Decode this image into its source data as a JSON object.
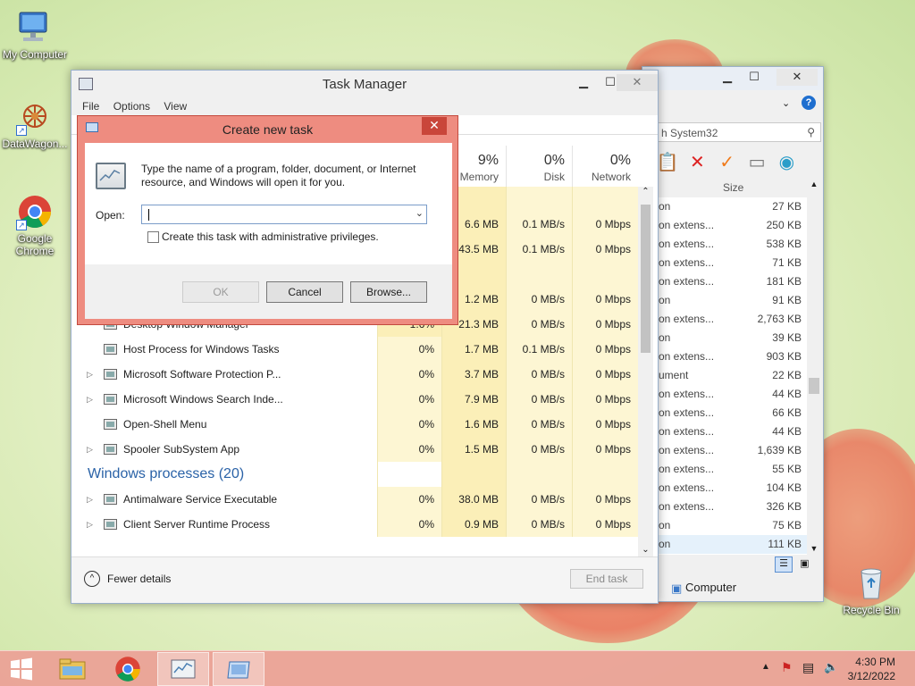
{
  "desktop": {
    "icons": [
      {
        "label": "My Computer",
        "icon": "computer-icon"
      },
      {
        "label": "DataWagon...",
        "icon": "datawagon-icon"
      },
      {
        "label": "Google Chrome",
        "icon": "chrome-icon"
      },
      {
        "label": "Recycle Bin",
        "icon": "recycle-bin-icon"
      }
    ]
  },
  "explorer": {
    "address": "h System32",
    "size_header": "Size",
    "status": "Computer",
    "rows": [
      {
        "name": "on",
        "size": "27 KB"
      },
      {
        "name": "on extens...",
        "size": "250 KB"
      },
      {
        "name": "on extens...",
        "size": "538 KB"
      },
      {
        "name": "on extens...",
        "size": "71 KB"
      },
      {
        "name": "on extens...",
        "size": "181 KB"
      },
      {
        "name": "on",
        "size": "91 KB"
      },
      {
        "name": "on extens...",
        "size": "2,763 KB"
      },
      {
        "name": "on",
        "size": "39 KB"
      },
      {
        "name": "on extens...",
        "size": "903 KB"
      },
      {
        "name": "ument",
        "size": "22 KB"
      },
      {
        "name": "on extens...",
        "size": "44 KB"
      },
      {
        "name": "on extens...",
        "size": "66 KB"
      },
      {
        "name": "on extens...",
        "size": "44 KB"
      },
      {
        "name": "on extens...",
        "size": "1,639 KB"
      },
      {
        "name": "on extens...",
        "size": "55 KB"
      },
      {
        "name": "on extens...",
        "size": "104 KB"
      },
      {
        "name": "on extens...",
        "size": "326 KB"
      },
      {
        "name": "on",
        "size": "75 KB"
      },
      {
        "name": "on",
        "size": "111 KB"
      }
    ]
  },
  "task_manager": {
    "title": "Task Manager",
    "menu": [
      "File",
      "Options",
      "View"
    ],
    "columns": [
      {
        "pct": "9%",
        "label": "Memory"
      },
      {
        "pct": "0%",
        "label": "Disk"
      },
      {
        "pct": "0%",
        "label": "Network"
      }
    ],
    "rows": [
      {
        "kind": "blank"
      },
      {
        "kind": "partial",
        "memory": "6.6 MB",
        "disk": "0.1 MB/s",
        "network": "0 Mbps"
      },
      {
        "kind": "partial",
        "memory": "43.5 MB",
        "disk": "0.1 MB/s",
        "network": "0 Mbps"
      },
      {
        "kind": "blank"
      },
      {
        "kind": "partial",
        "memory": "1.2 MB",
        "disk": "0 MB/s",
        "network": "0 Mbps"
      },
      {
        "kind": "proc",
        "name": "Desktop Window Manager",
        "cpu": "1.6%",
        "memory": "21.3 MB",
        "disk": "0 MB/s",
        "network": "0 Mbps",
        "expander": ""
      },
      {
        "kind": "proc",
        "name": "Host Process for Windows Tasks",
        "cpu": "0%",
        "memory": "1.7 MB",
        "disk": "0.1 MB/s",
        "network": "0 Mbps",
        "expander": ""
      },
      {
        "kind": "proc",
        "name": "Microsoft Software Protection P...",
        "cpu": "0%",
        "memory": "3.7 MB",
        "disk": "0 MB/s",
        "network": "0 Mbps",
        "expander": "▷"
      },
      {
        "kind": "proc",
        "name": "Microsoft Windows Search Inde...",
        "cpu": "0%",
        "memory": "7.9 MB",
        "disk": "0 MB/s",
        "network": "0 Mbps",
        "expander": "▷"
      },
      {
        "kind": "proc",
        "name": "Open-Shell Menu",
        "cpu": "0%",
        "memory": "1.6 MB",
        "disk": "0 MB/s",
        "network": "0 Mbps",
        "expander": ""
      },
      {
        "kind": "proc",
        "name": "Spooler SubSystem App",
        "cpu": "0%",
        "memory": "1.5 MB",
        "disk": "0 MB/s",
        "network": "0 Mbps",
        "expander": "▷"
      },
      {
        "kind": "group",
        "name": "Windows processes (20)"
      },
      {
        "kind": "proc",
        "name": "Antimalware Service Executable",
        "cpu": "0%",
        "memory": "38.0 MB",
        "disk": "0 MB/s",
        "network": "0 Mbps",
        "expander": "▷"
      },
      {
        "kind": "proc",
        "name": "Client Server Runtime Process",
        "cpu": "0%",
        "memory": "0.9 MB",
        "disk": "0 MB/s",
        "network": "0 Mbps",
        "expander": "▷"
      }
    ],
    "fewer_details": "Fewer details",
    "end_task": "End task"
  },
  "dialog": {
    "title": "Create new task",
    "message": "Type the name of a program, folder, document, or Internet resource, and Windows will open it for you.",
    "open_label": "Open:",
    "open_value": "",
    "admin_checkbox": "Create this task with administrative privileges.",
    "ok": "OK",
    "cancel": "Cancel",
    "browse": "Browse..."
  },
  "taskbar": {
    "time": "4:30 PM",
    "date": "3/12/2022"
  },
  "colors": {
    "accent": "#2a62a7",
    "dialog_frame": "#ee8c80",
    "close_red": "#c9463a",
    "heat_light": "#fdf6d3",
    "heat_mid": "#fbefb8"
  }
}
